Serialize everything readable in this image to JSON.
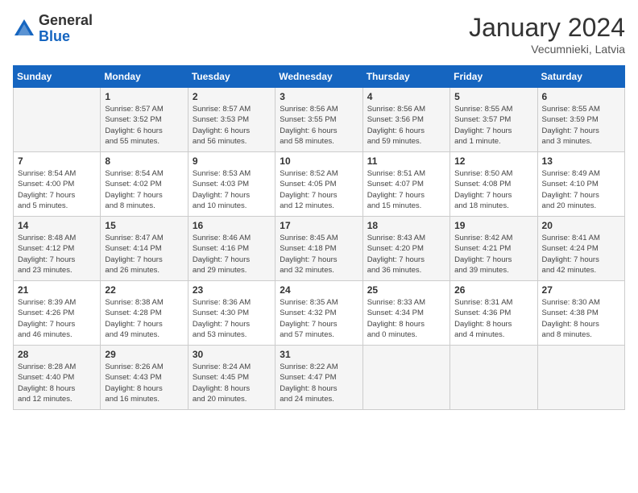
{
  "header": {
    "logo_general": "General",
    "logo_blue": "Blue",
    "month_year": "January 2024",
    "location": "Vecumnieki, Latvia"
  },
  "weekdays": [
    "Sunday",
    "Monday",
    "Tuesday",
    "Wednesday",
    "Thursday",
    "Friday",
    "Saturday"
  ],
  "weeks": [
    [
      {
        "day": "",
        "info": ""
      },
      {
        "day": "1",
        "info": "Sunrise: 8:57 AM\nSunset: 3:52 PM\nDaylight: 6 hours\nand 55 minutes."
      },
      {
        "day": "2",
        "info": "Sunrise: 8:57 AM\nSunset: 3:53 PM\nDaylight: 6 hours\nand 56 minutes."
      },
      {
        "day": "3",
        "info": "Sunrise: 8:56 AM\nSunset: 3:55 PM\nDaylight: 6 hours\nand 58 minutes."
      },
      {
        "day": "4",
        "info": "Sunrise: 8:56 AM\nSunset: 3:56 PM\nDaylight: 6 hours\nand 59 minutes."
      },
      {
        "day": "5",
        "info": "Sunrise: 8:55 AM\nSunset: 3:57 PM\nDaylight: 7 hours\nand 1 minute."
      },
      {
        "day": "6",
        "info": "Sunrise: 8:55 AM\nSunset: 3:59 PM\nDaylight: 7 hours\nand 3 minutes."
      }
    ],
    [
      {
        "day": "7",
        "info": "Sunrise: 8:54 AM\nSunset: 4:00 PM\nDaylight: 7 hours\nand 5 minutes."
      },
      {
        "day": "8",
        "info": "Sunrise: 8:54 AM\nSunset: 4:02 PM\nDaylight: 7 hours\nand 8 minutes."
      },
      {
        "day": "9",
        "info": "Sunrise: 8:53 AM\nSunset: 4:03 PM\nDaylight: 7 hours\nand 10 minutes."
      },
      {
        "day": "10",
        "info": "Sunrise: 8:52 AM\nSunset: 4:05 PM\nDaylight: 7 hours\nand 12 minutes."
      },
      {
        "day": "11",
        "info": "Sunrise: 8:51 AM\nSunset: 4:07 PM\nDaylight: 7 hours\nand 15 minutes."
      },
      {
        "day": "12",
        "info": "Sunrise: 8:50 AM\nSunset: 4:08 PM\nDaylight: 7 hours\nand 18 minutes."
      },
      {
        "day": "13",
        "info": "Sunrise: 8:49 AM\nSunset: 4:10 PM\nDaylight: 7 hours\nand 20 minutes."
      }
    ],
    [
      {
        "day": "14",
        "info": "Sunrise: 8:48 AM\nSunset: 4:12 PM\nDaylight: 7 hours\nand 23 minutes."
      },
      {
        "day": "15",
        "info": "Sunrise: 8:47 AM\nSunset: 4:14 PM\nDaylight: 7 hours\nand 26 minutes."
      },
      {
        "day": "16",
        "info": "Sunrise: 8:46 AM\nSunset: 4:16 PM\nDaylight: 7 hours\nand 29 minutes."
      },
      {
        "day": "17",
        "info": "Sunrise: 8:45 AM\nSunset: 4:18 PM\nDaylight: 7 hours\nand 32 minutes."
      },
      {
        "day": "18",
        "info": "Sunrise: 8:43 AM\nSunset: 4:20 PM\nDaylight: 7 hours\nand 36 minutes."
      },
      {
        "day": "19",
        "info": "Sunrise: 8:42 AM\nSunset: 4:21 PM\nDaylight: 7 hours\nand 39 minutes."
      },
      {
        "day": "20",
        "info": "Sunrise: 8:41 AM\nSunset: 4:24 PM\nDaylight: 7 hours\nand 42 minutes."
      }
    ],
    [
      {
        "day": "21",
        "info": "Sunrise: 8:39 AM\nSunset: 4:26 PM\nDaylight: 7 hours\nand 46 minutes."
      },
      {
        "day": "22",
        "info": "Sunrise: 8:38 AM\nSunset: 4:28 PM\nDaylight: 7 hours\nand 49 minutes."
      },
      {
        "day": "23",
        "info": "Sunrise: 8:36 AM\nSunset: 4:30 PM\nDaylight: 7 hours\nand 53 minutes."
      },
      {
        "day": "24",
        "info": "Sunrise: 8:35 AM\nSunset: 4:32 PM\nDaylight: 7 hours\nand 57 minutes."
      },
      {
        "day": "25",
        "info": "Sunrise: 8:33 AM\nSunset: 4:34 PM\nDaylight: 8 hours\nand 0 minutes."
      },
      {
        "day": "26",
        "info": "Sunrise: 8:31 AM\nSunset: 4:36 PM\nDaylight: 8 hours\nand 4 minutes."
      },
      {
        "day": "27",
        "info": "Sunrise: 8:30 AM\nSunset: 4:38 PM\nDaylight: 8 hours\nand 8 minutes."
      }
    ],
    [
      {
        "day": "28",
        "info": "Sunrise: 8:28 AM\nSunset: 4:40 PM\nDaylight: 8 hours\nand 12 minutes."
      },
      {
        "day": "29",
        "info": "Sunrise: 8:26 AM\nSunset: 4:43 PM\nDaylight: 8 hours\nand 16 minutes."
      },
      {
        "day": "30",
        "info": "Sunrise: 8:24 AM\nSunset: 4:45 PM\nDaylight: 8 hours\nand 20 minutes."
      },
      {
        "day": "31",
        "info": "Sunrise: 8:22 AM\nSunset: 4:47 PM\nDaylight: 8 hours\nand 24 minutes."
      },
      {
        "day": "",
        "info": ""
      },
      {
        "day": "",
        "info": ""
      },
      {
        "day": "",
        "info": ""
      }
    ]
  ]
}
